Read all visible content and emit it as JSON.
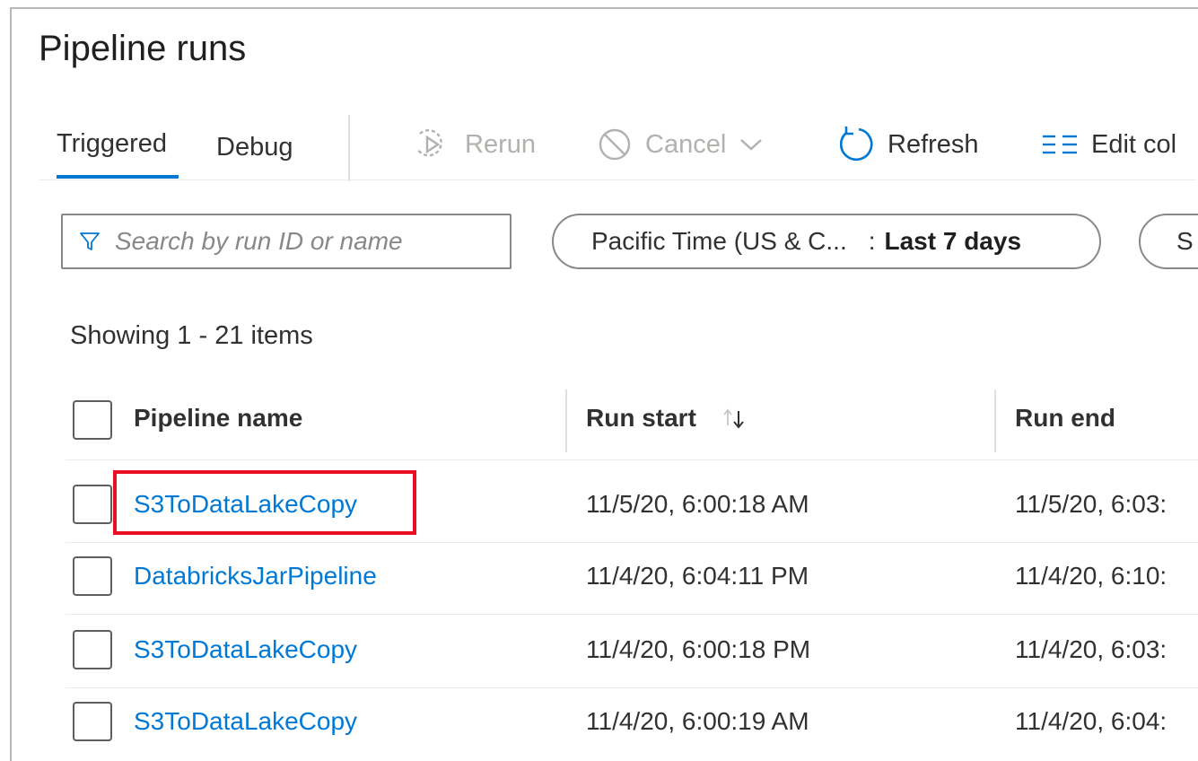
{
  "page": {
    "title": "Pipeline runs"
  },
  "tabs": [
    {
      "label": "Triggered",
      "active": true
    },
    {
      "label": "Debug",
      "active": false
    }
  ],
  "toolbar": {
    "rerun_label": "Rerun",
    "cancel_label": "Cancel",
    "refresh_label": "Refresh",
    "edit_columns_label": "Edit col"
  },
  "filters": {
    "search_placeholder": "Search by run ID or name",
    "timezone": "Pacific Time (US & C...",
    "time_separator": ":",
    "time_range": "Last 7 days",
    "next_filter_partial": "S"
  },
  "summary": {
    "showing": "Showing 1 - 21 items"
  },
  "columns": {
    "pipeline_name": "Pipeline name",
    "run_start": "Run start",
    "run_end": "Run end"
  },
  "rows": [
    {
      "name": "S3ToDataLakeCopy",
      "run_start": "11/5/20, 6:00:18 AM",
      "run_end": "11/5/20, 6:03:"
    },
    {
      "name": "DatabricksJarPipeline",
      "run_start": "11/4/20, 6:04:11 PM",
      "run_end": "11/4/20, 6:10:"
    },
    {
      "name": "S3ToDataLakeCopy",
      "run_start": "11/4/20, 6:00:18 PM",
      "run_end": "11/4/20, 6:03:"
    },
    {
      "name": "S3ToDataLakeCopy",
      "run_start": "11/4/20, 6:00:19 AM",
      "run_end": "11/4/20, 6:04:"
    }
  ],
  "colors": {
    "accent": "#0078d4",
    "highlight_box": "#e81123",
    "disabled_text": "#b3b0ad"
  },
  "icons": {
    "rerun": "rerun-icon",
    "cancel": "cancel-icon",
    "refresh": "refresh-icon",
    "edit_columns": "columns-icon",
    "search": "filter-funnel-icon",
    "sort": "sort-arrows-icon"
  }
}
